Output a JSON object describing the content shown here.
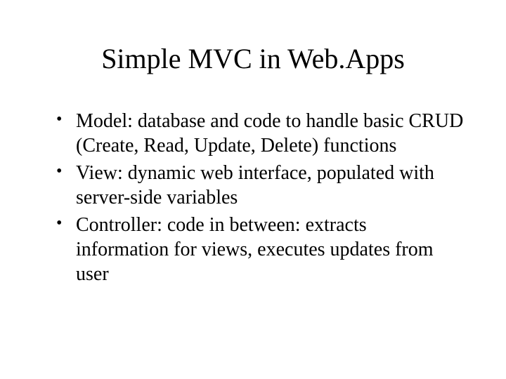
{
  "slide": {
    "title": "Simple MVC in Web.Apps",
    "bullets": [
      "Model: database and code to handle basic CRUD (Create, Read, Update, Delete) functions",
      "View: dynamic web interface, populated with server-side variables",
      "Controller: code in between: extracts information for views, executes updates from user"
    ]
  }
}
